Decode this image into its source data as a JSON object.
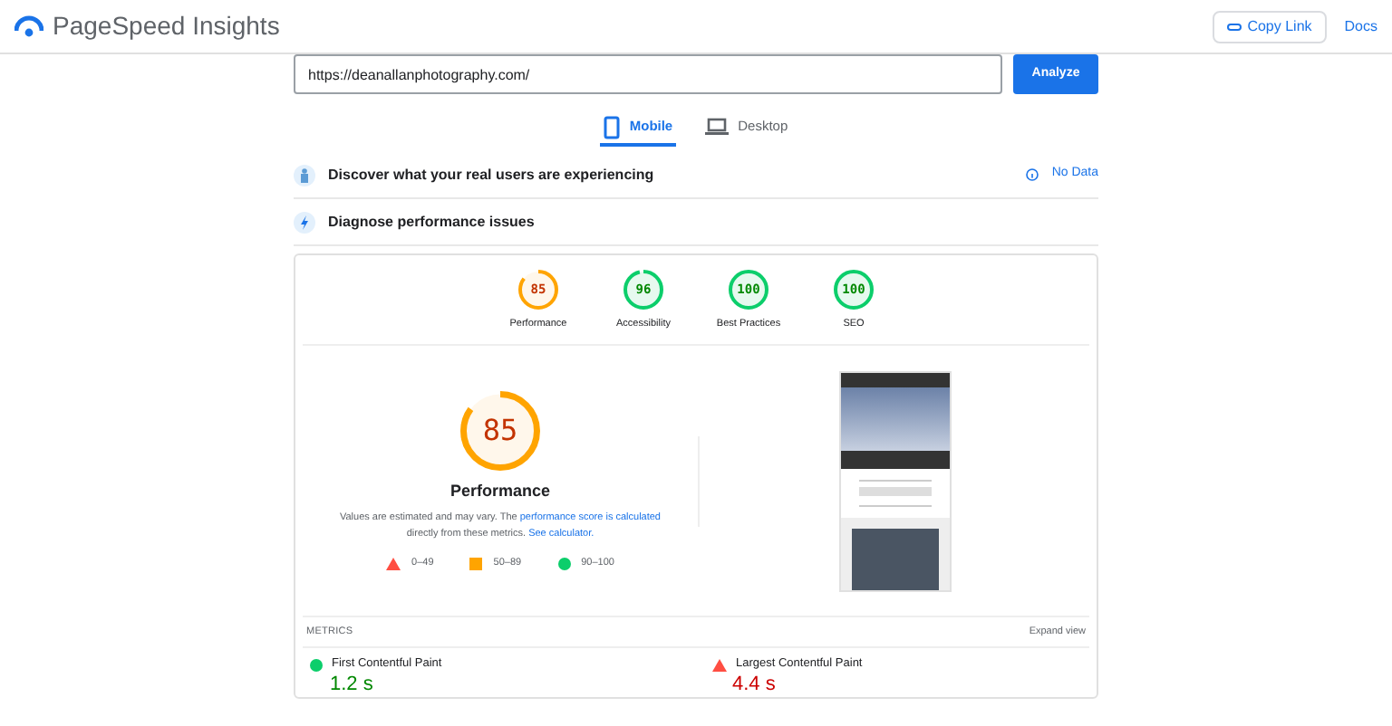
{
  "header": {
    "title": "PageSpeed Insights",
    "copy_link": "Copy Link",
    "docs": "Docs"
  },
  "url_field": {
    "value": "https://deanallanphotography.com/"
  },
  "analyze_button": "Analyze",
  "tabs": [
    {
      "label": "Mobile",
      "kind": "phone",
      "selected": true
    },
    {
      "label": "Desktop",
      "kind": "laptop",
      "selected": false
    }
  ],
  "field_data": {
    "title": "Discover what your real users are experiencing",
    "status": "No Data"
  },
  "diagnose": {
    "title": "Diagnose performance issues"
  },
  "scores": [
    {
      "score": "85",
      "label": "Performance",
      "color": "#ffa400"
    },
    {
      "score": "96",
      "label": "Accessibility",
      "color": "#0cce6b"
    },
    {
      "score": "100",
      "label": "Best Practices",
      "color": "#0cce6b"
    },
    {
      "score": "100",
      "label": "SEO",
      "color": "#0cce6b"
    }
  ],
  "main_score": {
    "score": "85",
    "label": "Performance",
    "color": "#ffa400",
    "note_before": "Values are estimated and may vary. The ",
    "note_link": "performance score is calculated",
    "note_middle": " directly from these metrics. ",
    "note_link2": "See calculator."
  },
  "legend": [
    {
      "kind": "fail",
      "label": "0–49"
    },
    {
      "kind": "average",
      "label": "50–89"
    },
    {
      "kind": "pass",
      "label": "90–100"
    }
  ],
  "metrics": {
    "heading": "METRICS",
    "expand": "Expand view",
    "items": [
      {
        "label": "First Contentful Paint",
        "value": "1.2 s",
        "kind": "pass",
        "color": "#0cce6b"
      },
      {
        "label": "Largest Contentful Paint",
        "value": "4.4 s",
        "kind": "fail",
        "color": "#ff4e42"
      }
    ]
  }
}
